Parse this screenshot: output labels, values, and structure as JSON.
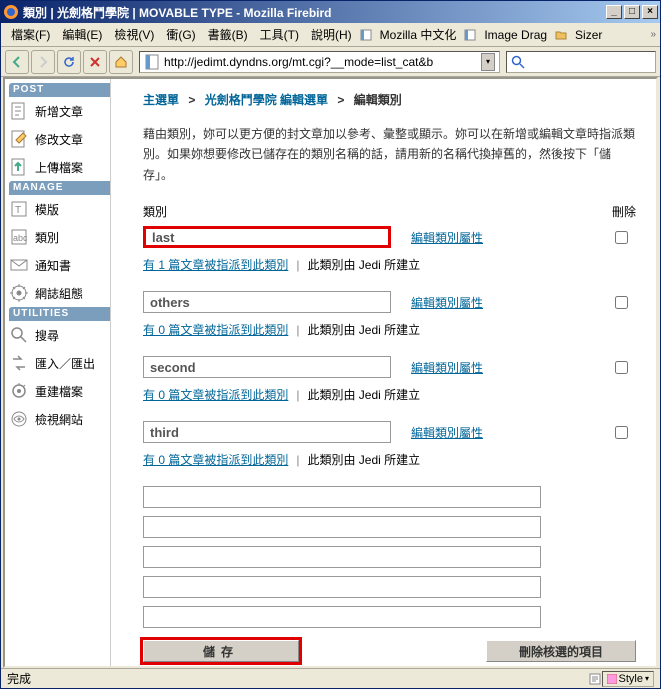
{
  "window": {
    "title": "類別 | 光劍格鬥學院 | MOVABLE TYPE - Mozilla Firebird"
  },
  "menubar": {
    "items": [
      "檔案(F)",
      "編輯(E)",
      "檢視(V)",
      "衝(G)",
      "書籤(B)",
      "工具(T)",
      "說明(H)"
    ],
    "bookmarks": [
      "Mozilla 中文化",
      "Image Drag",
      "Sizer"
    ]
  },
  "toolbar": {
    "url": "http://jedimt.dyndns.org/mt.cgi?__mode=list_cat&b"
  },
  "sidebar": {
    "sections": [
      {
        "header": "POST",
        "items": [
          {
            "label": "新增文章"
          },
          {
            "label": "修改文章"
          },
          {
            "label": "上傳檔案"
          }
        ]
      },
      {
        "header": "MANAGE",
        "items": [
          {
            "label": "模版"
          },
          {
            "label": "類別"
          },
          {
            "label": "通知書"
          },
          {
            "label": "網誌組態"
          }
        ]
      },
      {
        "header": "UTILITIES",
        "items": [
          {
            "label": "搜尋"
          },
          {
            "label": "匯入／匯出"
          },
          {
            "label": "重建檔案"
          },
          {
            "label": "檢視網站"
          }
        ]
      }
    ]
  },
  "main": {
    "breadcrumb": {
      "root": "主選單",
      "site": "光劍格鬥學院 編輯選單",
      "current": "編輯類別"
    },
    "desc": "藉由類別，妳可以更方便的封文章加以參考、彙整或顯示。妳可以在新增或編輯文章時指派類別。如果妳想要修改已儲存在的類別名稱的話，請用新的名稱代換掉舊的，然後按下「儲存」。",
    "col_cat": "類別",
    "col_del": "刪除",
    "edit_attr": "編輯類別屬性",
    "categories": [
      {
        "name": "last",
        "count": 1,
        "highlight": true
      },
      {
        "name": "others",
        "count": 0,
        "highlight": false
      },
      {
        "name": "second",
        "count": 0,
        "highlight": false
      },
      {
        "name": "third",
        "count": 0,
        "highlight": false
      }
    ],
    "sub_pre": "有 ",
    "sub_suf": " 篇文章被指派到此類別",
    "sub_by_pre": "此類別由 ",
    "sub_by_name": "Jedi",
    "sub_by_suf": " 所建立",
    "save_label": "儲存",
    "delsel_label": "刪除核選的項目"
  },
  "statusbar": {
    "status": "完成",
    "style": "Style"
  }
}
